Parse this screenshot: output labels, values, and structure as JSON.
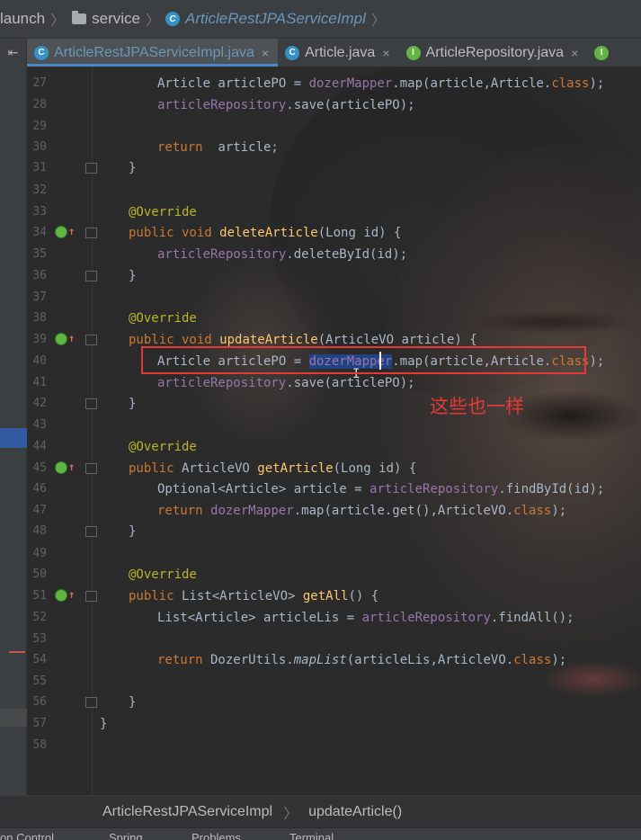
{
  "breadcrumb": {
    "items": [
      "launch",
      "service",
      "ArticleRestJPAServiceImpl"
    ]
  },
  "tabs": [
    {
      "label": "ArticleRestJPAServiceImpl.java",
      "icon": "class-icon",
      "active": true
    },
    {
      "label": "Article.java",
      "icon": "class-icon",
      "active": false
    },
    {
      "label": "ArticleRepository.java",
      "icon": "interface-icon",
      "active": false
    }
  ],
  "tab_close_glyph": "×",
  "line_numbers": [
    "27",
    "28",
    "29",
    "30",
    "31",
    "32",
    "33",
    "34",
    "35",
    "36",
    "37",
    "38",
    "39",
    "40",
    "41",
    "42",
    "43",
    "44",
    "45",
    "46",
    "47",
    "48",
    "49",
    "50",
    "51",
    "52",
    "53",
    "54",
    "55",
    "56",
    "57",
    "58"
  ],
  "annotation_text": "这些也一样",
  "bottom_breadcrumb": {
    "class_name": "ArticleRestJPAServiceImpl",
    "method_name": "updateArticle()"
  },
  "status_bar": {
    "items": [
      "on Control",
      "Spring",
      "Problems",
      "Terminal"
    ]
  },
  "colors": {
    "keyword": "#cc7832",
    "annotation": "#bbb529",
    "field": "#9876aa",
    "method_decl": "#ffc66d",
    "highlight_box": "#e53935",
    "active_tab_text": "#6897bb"
  }
}
